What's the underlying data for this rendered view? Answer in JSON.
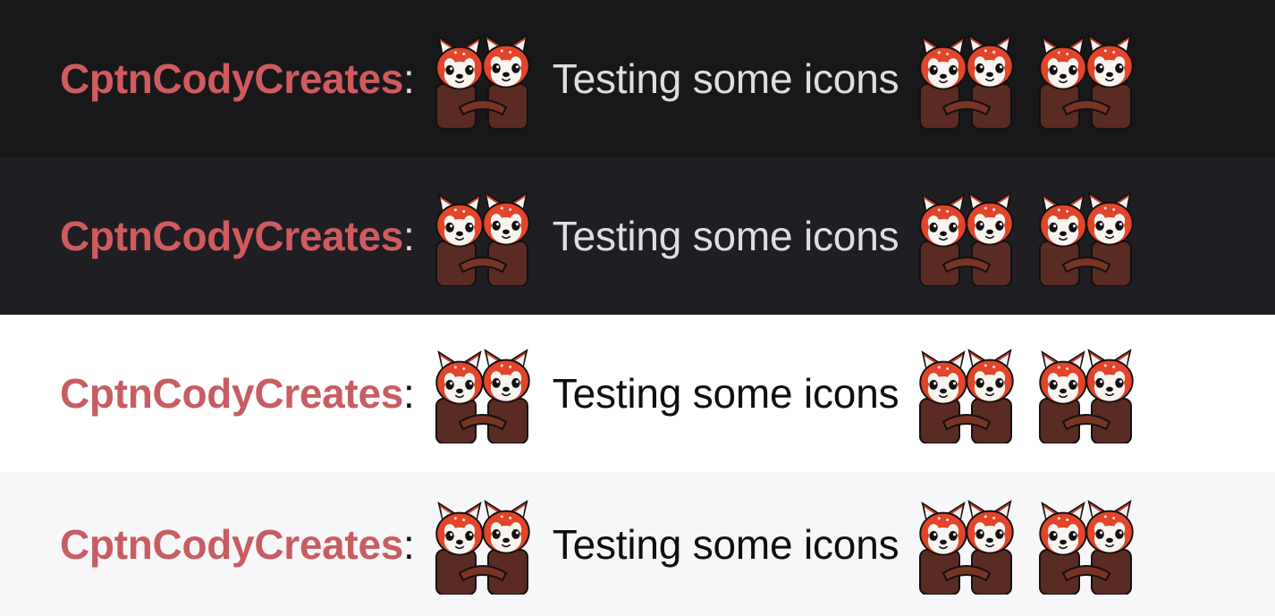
{
  "rows": [
    {
      "theme": "dark",
      "background": "#18181b",
      "text_color": "#dededf",
      "username": "CptnCodyCreates",
      "username_color": "#d05b5f",
      "separator": ":",
      "emote_before": "red-panda-handshake",
      "message": "Testing some icons",
      "emotes_after": [
        "red-panda-handshake",
        "red-panda-handshake"
      ]
    },
    {
      "theme": "dark-alt",
      "background": "#1f1e23",
      "text_color": "#dededf",
      "username": "CptnCodyCreates",
      "username_color": "#d05b5f",
      "separator": ":",
      "emote_before": "red-panda-handshake",
      "message": "Testing some icons",
      "emotes_after": [
        "red-panda-handshake",
        "red-panda-handshake"
      ]
    },
    {
      "theme": "light",
      "background": "#ffffff",
      "text_color": "#0e0e10",
      "username": "CptnCodyCreates",
      "username_color": "#c75d63",
      "separator": ":",
      "emote_before": "red-panda-handshake",
      "message": "Testing some icons",
      "emotes_after": [
        "red-panda-handshake",
        "red-panda-handshake"
      ]
    },
    {
      "theme": "light-alt",
      "background": "#f7f6f9",
      "text_color": "#0e0e10",
      "username": "CptnCodyCreates",
      "username_color": "#c75d63",
      "separator": ":",
      "emote_before": "red-panda-handshake",
      "message": "Testing some icons",
      "emotes_after": [
        "red-panda-handshake",
        "red-panda-handshake"
      ]
    }
  ]
}
